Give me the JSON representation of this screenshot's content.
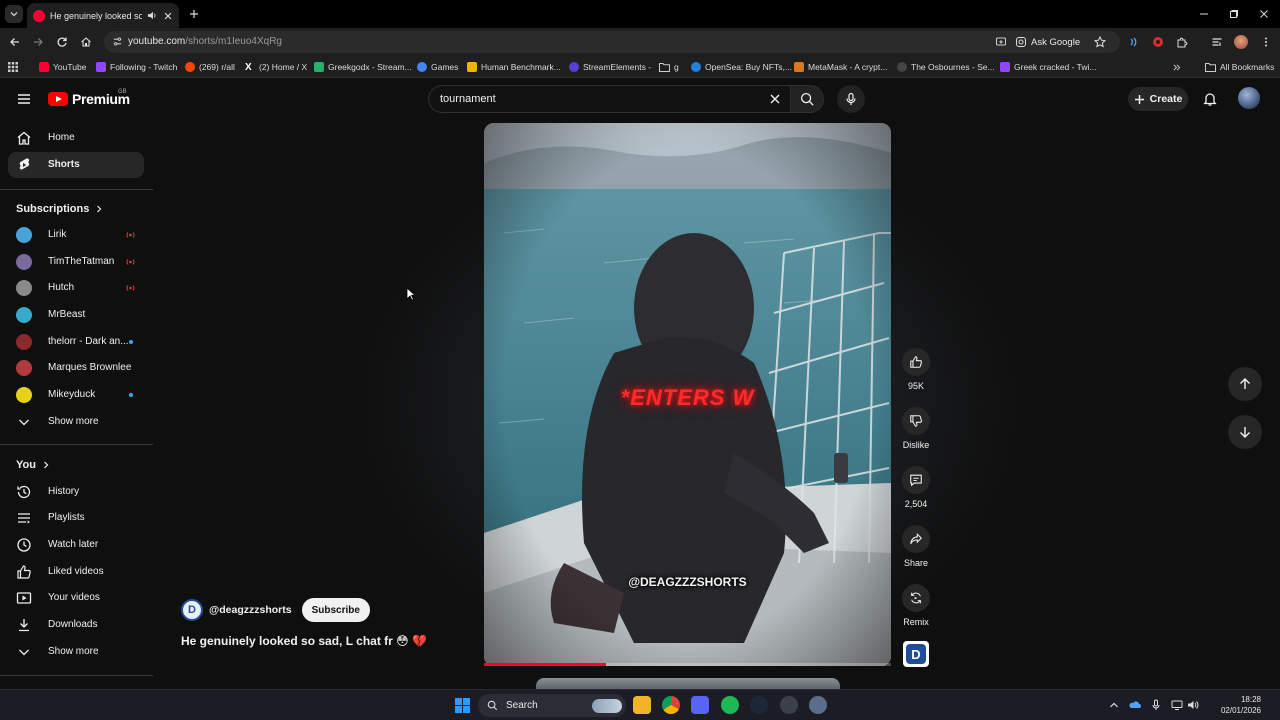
{
  "browser": {
    "tab_title": "He genuinely looked so sad, L chat fr",
    "url_domain": "youtube.com",
    "url_path": "/shorts/m1Ieuo4XqRg",
    "ask_google": "Ask Google",
    "bookmarks": [
      {
        "label": "YouTube",
        "color": "#ff0033"
      },
      {
        "label": "Following - Twitch",
        "color": "#9146ff"
      },
      {
        "label": "(269) r/all",
        "color": "#ff4500"
      },
      {
        "label": "(2) Home / X",
        "color": "#000000"
      },
      {
        "label": "Greekgodx - Stream...",
        "color": "#1fb36b"
      },
      {
        "label": "Games",
        "color": "#4285f4"
      },
      {
        "label": "Human Benchmark...",
        "color": "#f5b400"
      },
      {
        "label": "StreamElements -",
        "color": "#5a3fd6"
      },
      {
        "label": "g",
        "color": "#777777"
      },
      {
        "label": "OpenSea: Buy NFTs,...",
        "color": "#2081e2"
      },
      {
        "label": "MetaMask - A crypt...",
        "color": "#e2761b"
      },
      {
        "label": "The Osbournes - Se...",
        "color": "#222222"
      },
      {
        "label": "Greek cracked - Twi...",
        "color": "#9146ff"
      }
    ],
    "all_bookmarks": "All Bookmarks"
  },
  "header": {
    "logo_word": "Premium",
    "region": "GB",
    "search_query": "tournament",
    "create_label": "Create"
  },
  "sidebar": {
    "main": [
      {
        "label": "Home",
        "icon": "home-icon"
      },
      {
        "label": "Shorts",
        "icon": "shorts-icon"
      }
    ],
    "subscriptions_title": "Subscriptions",
    "subscriptions": [
      {
        "name": "Lirik",
        "status": "live",
        "color": "#4aa3d8"
      },
      {
        "name": "TimTheTatman",
        "status": "live",
        "color": "#7a6a9c"
      },
      {
        "name": "Hutch",
        "status": "live",
        "color": "#8a8a8a"
      },
      {
        "name": "MrBeast",
        "status": "",
        "color": "#3aa8c8"
      },
      {
        "name": "thelorr - Dark an...",
        "status": "new",
        "color": "#8a2a2a"
      },
      {
        "name": "Marques Brownlee",
        "status": "",
        "color": "#b33a3a"
      },
      {
        "name": "Mikeyduck",
        "status": "new",
        "color": "#e6d21a"
      }
    ],
    "show_more": "Show more",
    "you_title": "You",
    "you_items": [
      {
        "label": "History",
        "icon": "history-icon"
      },
      {
        "label": "Playlists",
        "icon": "playlists-icon"
      },
      {
        "label": "Watch later",
        "icon": "watch-later-icon"
      },
      {
        "label": "Liked videos",
        "icon": "liked-videos-icon"
      },
      {
        "label": "Your videos",
        "icon": "your-videos-icon"
      },
      {
        "label": "Downloads",
        "icon": "downloads-icon"
      }
    ],
    "show_more_2": "Show more"
  },
  "short": {
    "overlay_text": "*ENTERS W",
    "watermark": "@DEAGZZZSHORTS",
    "progress": 0.3,
    "channel_handle": "@deagzzzshorts",
    "subscribe_label": "Subscribe",
    "title": "He genuinely looked so sad, L chat fr 😳 💔",
    "likes": "95K",
    "dislike_label": "Dislike",
    "comments": "2,504",
    "share_label": "Share",
    "remix_label": "Remix"
  },
  "taskbar": {
    "search_label": "Search",
    "time": "18:28",
    "date": "02/01/2026"
  }
}
